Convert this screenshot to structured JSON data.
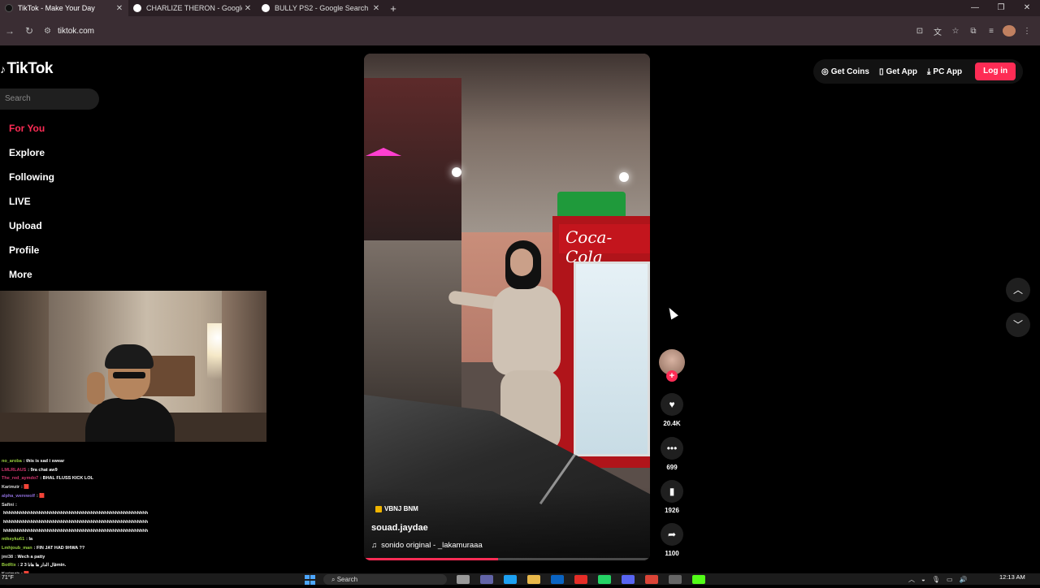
{
  "browser": {
    "tabs": [
      {
        "title": "TikTok - Make Your Day",
        "active": true,
        "favicon_color": "#111111"
      },
      {
        "title": "CHARLIZE THERON - Google Sea",
        "active": false,
        "favicon_color": "#4285f4"
      },
      {
        "title": "BULLY PS2 - Google Search",
        "active": false,
        "favicon_color": "#4285f4"
      }
    ],
    "url": "tiktok.com"
  },
  "tiktok": {
    "logo": "TikTok",
    "search_placeholder": "Search",
    "nav": [
      "For You",
      "Explore",
      "Following",
      "LIVE",
      "Upload",
      "Profile",
      "More"
    ],
    "top_actions": {
      "get_coins": "Get Coins",
      "get_app": "Get App",
      "pc_app": "PC App",
      "login": "Log in"
    },
    "video": {
      "tag": "VBNJ BNM",
      "author": "souad.jaydae",
      "sound": "sonido original - _lakamuraaa",
      "fridge_text": "Coca-Cola",
      "progress": 0.47
    },
    "actions": {
      "likes": "20.4K",
      "comments": "699",
      "saves": "1926",
      "shares": "1100"
    }
  },
  "chat": [
    {
      "user": "no_aroba",
      "user_color": "#9ad23f",
      "msg": ": this is sad i swear"
    },
    {
      "user": "LMLRLAUS",
      "user_color": "#d1356e",
      "msg": ": 9ra chat aw9"
    },
    {
      "user": "The_red_aymdo7",
      "user_color": "#d1356e",
      "msg": ": BHAL FLUSS KICK LOL"
    },
    {
      "user": "Karimzir",
      "user_color": "#dddddd",
      "msg": ": 🟥"
    },
    {
      "user": "alpha_werewolf",
      "user_color": "#8c6cd6",
      "msg": ": 🟥"
    },
    {
      "user": "Safini",
      "user_color": "#dddddd",
      "msg": ":"
    },
    {
      "user": "",
      "user_color": "#dddddd",
      "msg": "hhhhhhhhhhhhhhhhhhhhhhhhhhhhhhhhhhhhhhhhhhhhhhhhhhhhh"
    },
    {
      "user": "",
      "user_color": "#dddddd",
      "msg": "hhhhhhhhhhhhhhhhhhhhhhhhhhhhhhhhhhhhhhhhhhhhhhhhhhhhh"
    },
    {
      "user": "",
      "user_color": "#dddddd",
      "msg": "hhhhhhhhhhhhhhhhhhhhhhhhhhhhhhhhhhhhhhhhhhhhhhhhhhhhh"
    },
    {
      "user": "mikeyku61",
      "user_color": "#9ad23f",
      "msg": ": la"
    },
    {
      "user": "Lmhjoub_man",
      "user_color": "#9ad23f",
      "msg": ": FIN JAT HAD 9HWA ??"
    },
    {
      "user": "jmi38",
      "user_color": "#dddddd",
      "msg": ": Wech a patty"
    },
    {
      "user": "BotRix",
      "user_color": "#9ad23f",
      "msg": ": 2 قال الدار ها هانا 3min."
    },
    {
      "user": "Karimzir",
      "user_color": "#dddddd",
      "msg": ": 🟥"
    },
    {
      "user": "",
      "user_color": "#d1356e",
      "msg": ": 🟥"
    }
  ],
  "taskbar": {
    "weather": "71°F",
    "search": "Search",
    "time": "12:13 AM"
  }
}
